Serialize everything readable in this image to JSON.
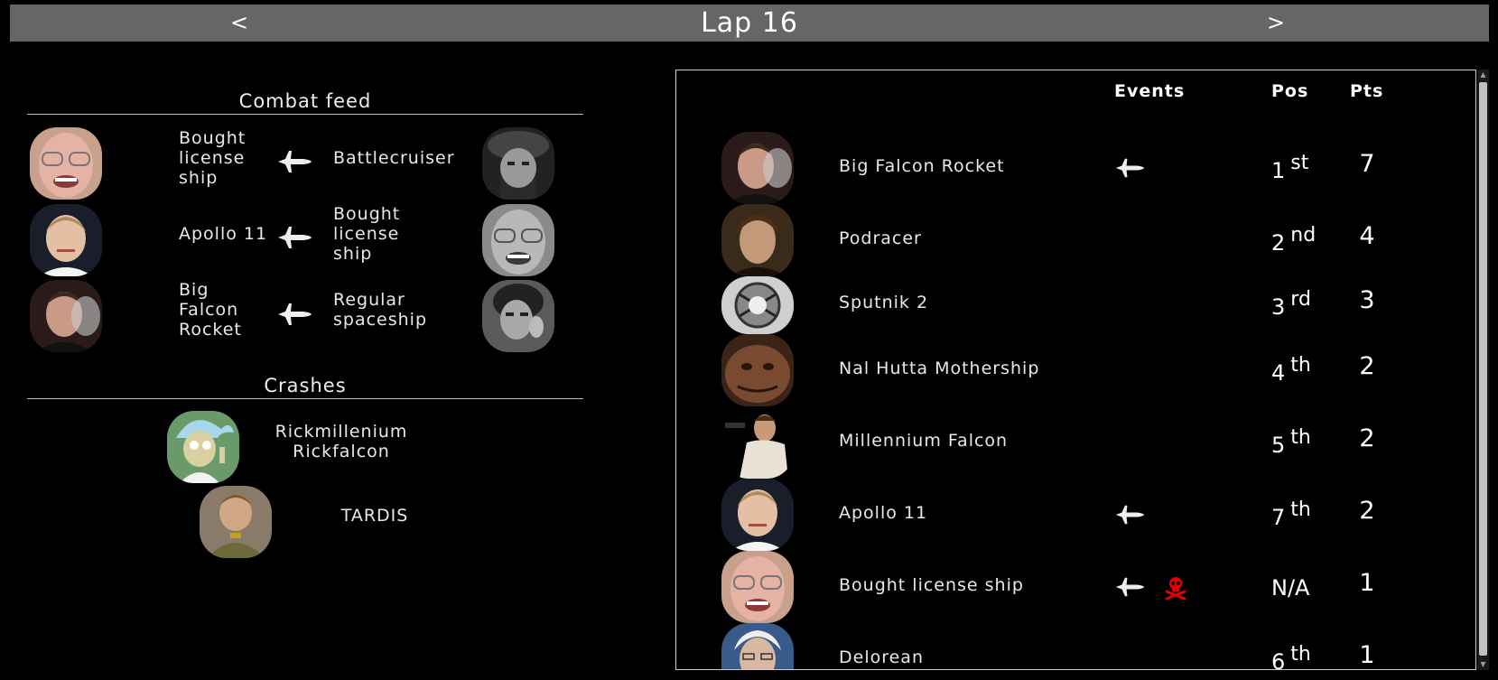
{
  "lap": {
    "title": "Lap 16",
    "prev_label": "<",
    "next_label": ">"
  },
  "combat_feed": {
    "title": "Combat feed",
    "entries": [
      {
        "attacker": "Bought license ship",
        "attacker_lines": [
          "Bought",
          "license",
          "ship"
        ],
        "defender": "Battlecruiser",
        "defender_lines": [
          "Battlecruiser"
        ],
        "icon": "fighter-jet-icon"
      },
      {
        "attacker": "Apollo 11",
        "attacker_lines": [
          "Apollo 11"
        ],
        "defender": "Bought license ship",
        "defender_lines": [
          "Bought",
          "license",
          "ship"
        ],
        "icon": "fighter-jet-icon"
      },
      {
        "attacker": "Big Falcon Rocket",
        "attacker_lines": [
          "Big",
          "Falcon",
          "Rocket"
        ],
        "defender": "Regular spaceship",
        "defender_lines": [
          "Regular",
          "spaceship"
        ],
        "icon": "fighter-jet-icon"
      }
    ]
  },
  "crashes": {
    "title": "Crashes",
    "entries": [
      {
        "name_lines": [
          "Rickmillenium",
          "Rickfalcon"
        ]
      },
      {
        "name_lines": [
          "TARDIS"
        ]
      }
    ]
  },
  "standings": {
    "headers": {
      "events": "Events",
      "pos": "Pos",
      "pts": "Pts"
    },
    "rows": [
      {
        "name": "Big Falcon Rocket",
        "events": [
          "fighter-jet-icon"
        ],
        "pos": "1",
        "suffix": "st",
        "pts": "7"
      },
      {
        "name": "Podracer",
        "events": [],
        "pos": "2",
        "suffix": "nd",
        "pts": "4"
      },
      {
        "name": "Sputnik 2",
        "events": [],
        "pos": "3",
        "suffix": "rd",
        "pts": "3"
      },
      {
        "name": "Nal Hutta Mothership",
        "events": [],
        "pos": "4",
        "suffix": "th",
        "pts": "2"
      },
      {
        "name": "Millennium Falcon",
        "events": [],
        "pos": "5",
        "suffix": "th",
        "pts": "2"
      },
      {
        "name": "Apollo 11",
        "events": [
          "fighter-jet-icon"
        ],
        "pos": "7",
        "suffix": "th",
        "pts": "2"
      },
      {
        "name": "Bought license ship",
        "events": [
          "fighter-jet-icon",
          "skull-crossbones-icon"
        ],
        "pos": "N/A",
        "suffix": "",
        "pts": "1"
      },
      {
        "name": "Delorean",
        "events": [],
        "pos": "6",
        "suffix": "th",
        "pts": "1"
      }
    ]
  },
  "colors": {
    "lap_bar": "#666666",
    "background": "#000000",
    "skull": "#e00000",
    "icon": "#eeeeee"
  }
}
